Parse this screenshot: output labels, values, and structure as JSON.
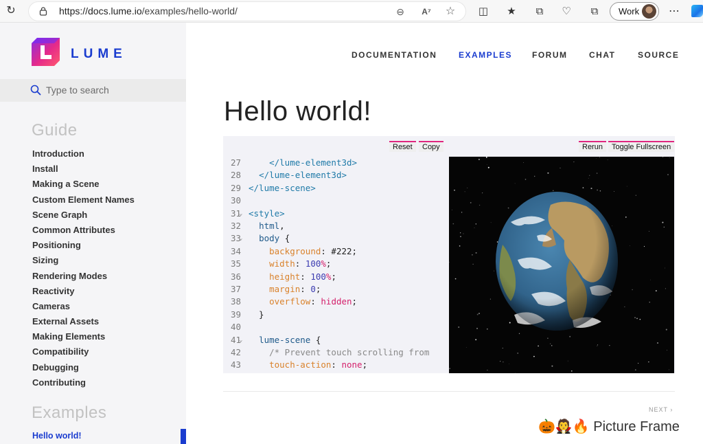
{
  "browser": {
    "url_host": "https://docs.lume.io",
    "url_path": "/examples/hello-world/",
    "profile_label": "Work",
    "icons": [
      "reload-icon",
      "lock-icon",
      "zoom-out-icon",
      "read-aloud-icon",
      "favorite-star-icon",
      "split-screen-icon",
      "favorites-icon",
      "collections-icon",
      "browser-essentials-icon",
      "extensions-icon",
      "more-icon",
      "copilot-icon"
    ]
  },
  "sidebar": {
    "brand": "LUME",
    "search_placeholder": "Type to search",
    "guide_title": "Guide",
    "guide_items": [
      "Introduction",
      "Install",
      "Making a Scene",
      "Custom Element Names",
      "Scene Graph",
      "Common Attributes",
      "Positioning",
      "Sizing",
      "Rendering Modes",
      "Reactivity",
      "Cameras",
      "External Assets",
      "Making Elements",
      "Compatibility",
      "Debugging",
      "Contributing"
    ],
    "examples_title": "Examples",
    "active_item": "Hello world!"
  },
  "topnav": [
    "DOCUMENTATION",
    "EXAMPLES",
    "FORUM",
    "CHAT",
    "SOURCE"
  ],
  "topnav_active": "EXAMPLES",
  "page_title": "Hello world!",
  "example": {
    "buttons": {
      "reset": "Reset",
      "copy": "Copy",
      "rerun": "Rerun",
      "fullscreen": "Toggle Fullscreen"
    },
    "code_lines": [
      {
        "n": "27",
        "fold": false,
        "tokens": [
          [
            "pl",
            "    "
          ],
          [
            "tag",
            "</lume-element3d>"
          ]
        ]
      },
      {
        "n": "28",
        "fold": false,
        "tokens": [
          [
            "pl",
            "  "
          ],
          [
            "tag",
            "</lume-element3d>"
          ]
        ]
      },
      {
        "n": "29",
        "fold": false,
        "tokens": [
          [
            "tag",
            "</lume-scene>"
          ]
        ]
      },
      {
        "n": "30",
        "fold": false,
        "tokens": []
      },
      {
        "n": "31",
        "fold": true,
        "tokens": [
          [
            "tag",
            "<style>"
          ]
        ]
      },
      {
        "n": "32",
        "fold": false,
        "tokens": [
          [
            "pl",
            "  "
          ],
          [
            "sel",
            "html"
          ],
          [
            "pl",
            ","
          ]
        ]
      },
      {
        "n": "33",
        "fold": true,
        "tokens": [
          [
            "pl",
            "  "
          ],
          [
            "sel",
            "body"
          ],
          [
            "pl",
            " {"
          ]
        ]
      },
      {
        "n": "34",
        "fold": false,
        "tokens": [
          [
            "pl",
            "    "
          ],
          [
            "prop",
            "background"
          ],
          [
            "pl",
            ": #222;"
          ]
        ]
      },
      {
        "n": "35",
        "fold": false,
        "tokens": [
          [
            "pl",
            "    "
          ],
          [
            "prop",
            "width"
          ],
          [
            "pl",
            ": "
          ],
          [
            "num",
            "100"
          ],
          [
            "kw",
            "%"
          ],
          [
            "pl",
            ";"
          ]
        ]
      },
      {
        "n": "36",
        "fold": false,
        "tokens": [
          [
            "pl",
            "    "
          ],
          [
            "prop",
            "height"
          ],
          [
            "pl",
            ": "
          ],
          [
            "num",
            "100"
          ],
          [
            "kw",
            "%"
          ],
          [
            "pl",
            ";"
          ]
        ]
      },
      {
        "n": "37",
        "fold": false,
        "tokens": [
          [
            "pl",
            "    "
          ],
          [
            "prop",
            "margin"
          ],
          [
            "pl",
            ": "
          ],
          [
            "num",
            "0"
          ],
          [
            "pl",
            ";"
          ]
        ]
      },
      {
        "n": "38",
        "fold": false,
        "tokens": [
          [
            "pl",
            "    "
          ],
          [
            "prop",
            "overflow"
          ],
          [
            "pl",
            ": "
          ],
          [
            "kw",
            "hidden"
          ],
          [
            "pl",
            ";"
          ]
        ]
      },
      {
        "n": "39",
        "fold": false,
        "tokens": [
          [
            "pl",
            "  }"
          ]
        ]
      },
      {
        "n": "40",
        "fold": false,
        "tokens": []
      },
      {
        "n": "41",
        "fold": true,
        "tokens": [
          [
            "pl",
            "  "
          ],
          [
            "sel",
            "lume-scene"
          ],
          [
            "pl",
            " {"
          ]
        ]
      },
      {
        "n": "42",
        "fold": false,
        "tokens": [
          [
            "pl",
            "    "
          ],
          [
            "com",
            "/* Prevent touch scrolling from"
          ]
        ]
      },
      {
        "n": "43",
        "fold": false,
        "tokens": [
          [
            "pl",
            "    "
          ],
          [
            "prop",
            "touch-action"
          ],
          [
            "pl",
            ": "
          ],
          [
            "kw",
            "none"
          ],
          [
            "pl",
            ";"
          ]
        ]
      }
    ]
  },
  "next": {
    "label": "NEXT",
    "title": "🎃🧛🔥 Picture Frame"
  },
  "colors": {
    "accent": "#1a3ccf",
    "button_border": "#e0267f",
    "sidebar_bg": "#f5f5f7"
  }
}
